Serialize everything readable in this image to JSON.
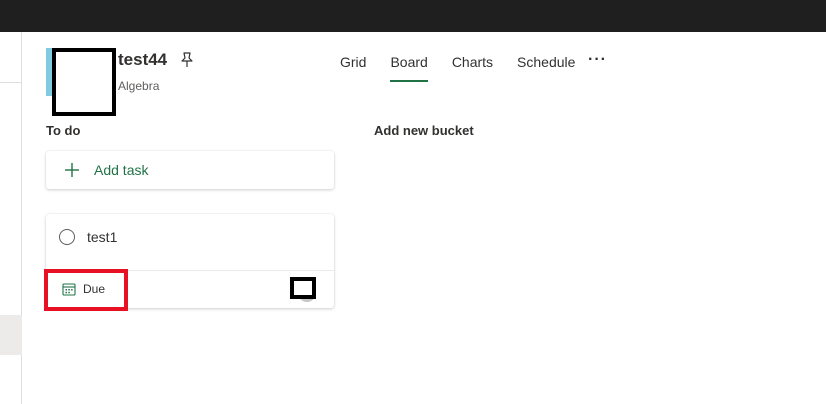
{
  "plan": {
    "title": "test44",
    "group": "Algebra",
    "color": "#7fcbe0"
  },
  "tabs": [
    {
      "label": "Grid"
    },
    {
      "label": "Board",
      "active": true
    },
    {
      "label": "Charts"
    },
    {
      "label": "Schedule"
    }
  ],
  "more_label": "···",
  "bucket": {
    "title": "To do",
    "add_task_label": "Add task",
    "tasks": [
      {
        "name": "test1",
        "due_label": "Due"
      }
    ]
  },
  "add_bucket_label": "Add new bucket",
  "colors": {
    "accent": "#217346",
    "highlight": "#e81123",
    "topbar": "#1f1f1f"
  }
}
